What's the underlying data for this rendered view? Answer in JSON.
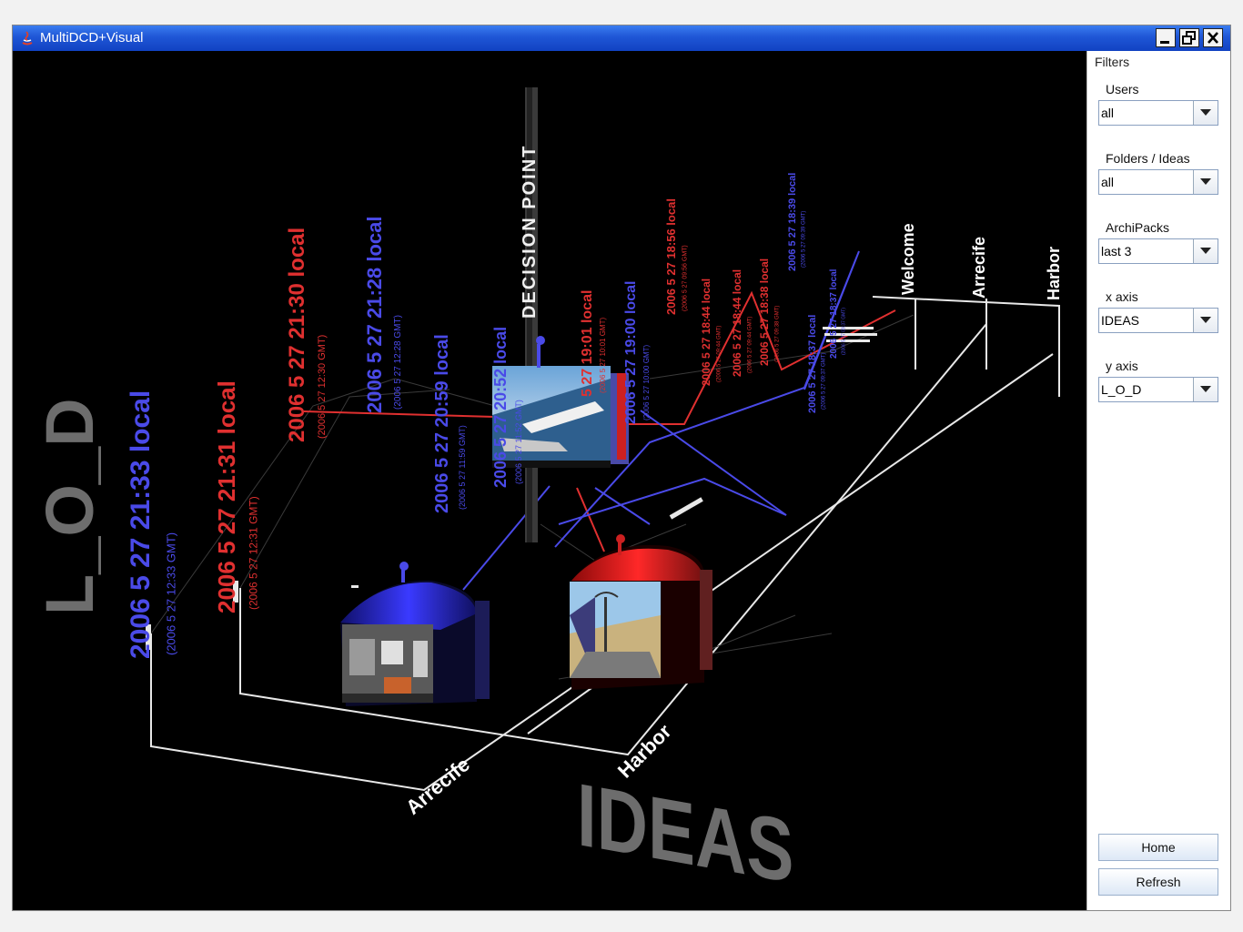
{
  "window": {
    "title": "MultiDCD+Visual",
    "controls": [
      "minimize-icon",
      "restore-icon",
      "close-icon"
    ]
  },
  "scene": {
    "y_axis_title": "L_O_D",
    "x_axis_title": "IDEAS",
    "decision_point_label": "DECISION POINT",
    "colors": {
      "red": "#e03030",
      "blue": "#4a4ae8",
      "axis_grey": "#6d6d6d",
      "line_white": "#e8e8e8"
    },
    "x_axis_labels_front": [
      "Arrecife",
      "Harbor"
    ],
    "x_axis_labels_back": [
      "Welcome",
      "Arrecife",
      "Harbor"
    ],
    "timestamps": [
      {
        "local": "2006 5 27 21:33 local",
        "gmt": "(2006 5 27 12:33 GMT)",
        "color": "blue"
      },
      {
        "local": "2006 5 27 21:31 local",
        "gmt": "(2006 5 27 12:31 GMT)",
        "color": "red"
      },
      {
        "local": "2006 5 27 21:30 local",
        "gmt": "(2006 5 27 12:30 GMT)",
        "color": "red"
      },
      {
        "local": "2006 5 27 21:28 local",
        "gmt": "(2006 5 27 12:28 GMT)",
        "color": "blue"
      },
      {
        "local": "2006 5 27 20:59 local",
        "gmt": "(2006 5 27 11:59 GMT)",
        "color": "blue"
      },
      {
        "local": "2006 5 27 20:52 local",
        "gmt": "(2006 5 27 11:52 GMT)",
        "color": "blue"
      },
      {
        "local": "5 27 19:01 local",
        "gmt": "(2006 5 27 10:01 GMT)",
        "color": "red"
      },
      {
        "local": "2006 5 27 19:00 local",
        "gmt": "(2006 5 27 10:00 GMT)",
        "color": "blue"
      },
      {
        "local": "2006 5 27 18:56 local",
        "gmt": "(2006 5 27 09:56 GMT)",
        "color": "red"
      },
      {
        "local": "2006 5 27 18:44 local",
        "gmt": "(2006 5 27 09:44 GMT)",
        "color": "red"
      },
      {
        "local": "2006 5 27 18:44 local",
        "gmt": "(2006 5 27 09:44 GMT)",
        "color": "red"
      },
      {
        "local": "2006 5 27 18:38 local",
        "gmt": "(2006 5 27 09:38 GMT)",
        "color": "red"
      },
      {
        "local": "2006 5 27 18:39 local",
        "gmt": "(2006 5 27 09:39 GMT)",
        "color": "blue"
      },
      {
        "local": "2006 5 27 18:37 local",
        "gmt": "(2006 5 27 09:37 GMT)",
        "color": "blue"
      },
      {
        "local": "2006 5 27 18:37 local",
        "gmt": "(2006 5 27 09:37 GMT)",
        "color": "blue"
      }
    ]
  },
  "filters": {
    "title": "Filters",
    "users": {
      "label": "Users",
      "value": "all"
    },
    "folders": {
      "label": "Folders / Ideas",
      "value": "all"
    },
    "archipacks": {
      "label": "ArchiPacks",
      "value": "last 3"
    },
    "x_axis": {
      "label": "x axis",
      "value": "IDEAS"
    },
    "y_axis": {
      "label": "y axis",
      "value": "L_O_D"
    }
  },
  "buttons": {
    "home": "Home",
    "refresh": "Refresh"
  }
}
